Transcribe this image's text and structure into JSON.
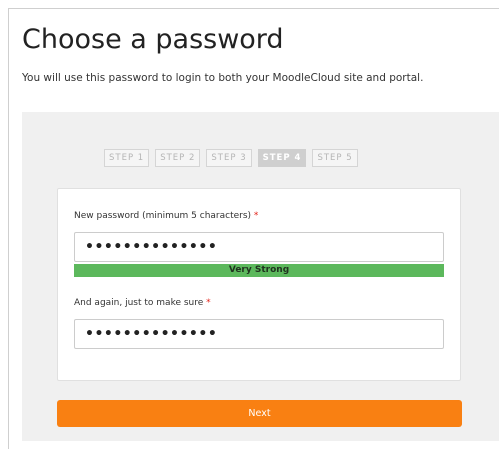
{
  "page": {
    "title": "Choose a password",
    "subtitle": "You will use this password to login to both your MoodleCloud site and portal."
  },
  "steps": [
    {
      "label": "STEP 1",
      "active": false
    },
    {
      "label": "STEP 2",
      "active": false
    },
    {
      "label": "STEP 3",
      "active": false
    },
    {
      "label": "STEP 4",
      "active": true
    },
    {
      "label": "STEP 5",
      "active": false
    }
  ],
  "form": {
    "password_label": "New password (minimum 5 characters)",
    "password_value": "••••••••••••••",
    "strength_text": "Very Strong",
    "confirm_label": "And again, just to make sure",
    "confirm_value": "••••••••••••••",
    "required_marker": "*"
  },
  "actions": {
    "next_label": "Next"
  },
  "colors": {
    "accent": "#f98012",
    "strength": "#5cb85c",
    "required": "#e2231a"
  }
}
